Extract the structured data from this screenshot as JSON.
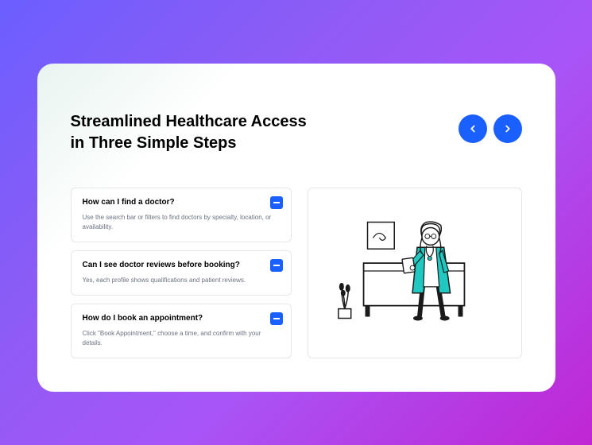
{
  "title": "Streamlined Healthcare Access in Three Simple Steps",
  "faq": [
    {
      "question": "How can I find a doctor?",
      "answer": "Use the search bar or filters to find doctors by specialty, location, or availability."
    },
    {
      "question": "Can I see doctor reviews before booking?",
      "answer": "Yes, each profile shows qualifications and patient reviews."
    },
    {
      "question": "How do I book an appointment?",
      "answer": "Click \"Book Appointment,\" choose a time, and confirm with your details."
    }
  ]
}
